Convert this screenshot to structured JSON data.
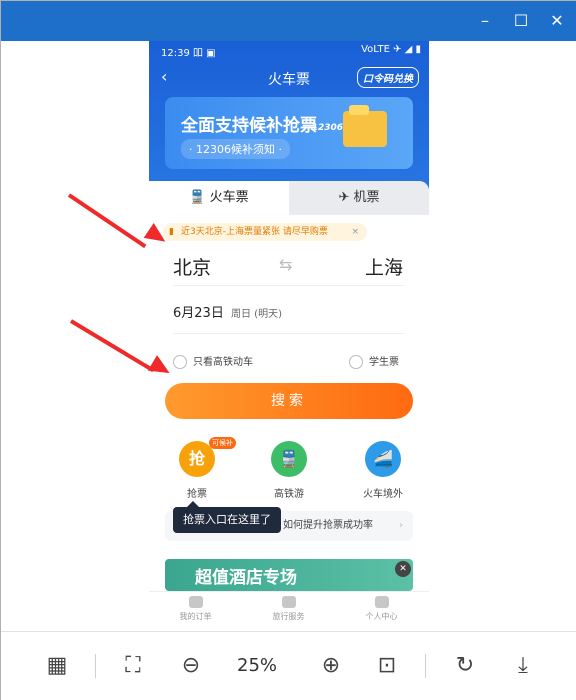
{
  "window": {
    "min_label": "–",
    "max_label": "☐",
    "close_label": "✕"
  },
  "phone": {
    "status": {
      "time": "12:39 吅 ▣",
      "right": "VoLTE ✈ ◢ ▮"
    },
    "nav": {
      "back": "‹",
      "title": "火车票",
      "code_exchange": "口令码兑换"
    },
    "banner": {
      "headline": "全面支持候补抢票",
      "sub": "· 12306候补须知 ·",
      "number": "12306"
    },
    "tabs": {
      "train": "🚆 火车票",
      "flight": "✈ 机票"
    },
    "notice": {
      "text": "近3天北京-上海票量紧张 请尽早购票",
      "close": "×"
    },
    "from": "北京",
    "to": "上海",
    "swap": "⇆",
    "date": "6月23日",
    "weekday": "周日 (明天)",
    "option_hsr": "只看高铁动车",
    "option_student": "学生票",
    "search_label": "搜索",
    "features": [
      {
        "label": "抢票",
        "badge": "可候补",
        "glyph": "抢",
        "color": "#f7a20a"
      },
      {
        "label": "高铁游",
        "glyph": "🚆",
        "color": "#3cbd66"
      },
      {
        "label": "火车境外",
        "glyph": "🚄",
        "color": "#2e9be8"
      }
    ],
    "tooltip": "抢票入口在这里了",
    "help": "如何提升抢票成功率",
    "help_chevron": "›",
    "ad": {
      "text": "超值酒店专场",
      "close": "✕"
    },
    "tabbar": [
      "我的订单",
      "旅行服务",
      "个人中心"
    ]
  },
  "toolbar": {
    "zoom": "25%",
    "icons": [
      "layout-icon",
      "fit-screen-icon",
      "zoom-out-icon",
      "zoom-in-icon",
      "actual-size-icon",
      "rotate-icon",
      "download-icon"
    ]
  },
  "colors": {
    "titlebar": "#1e6fc9",
    "accent": "#ff6a10",
    "arrow": "#ee2a2a"
  }
}
